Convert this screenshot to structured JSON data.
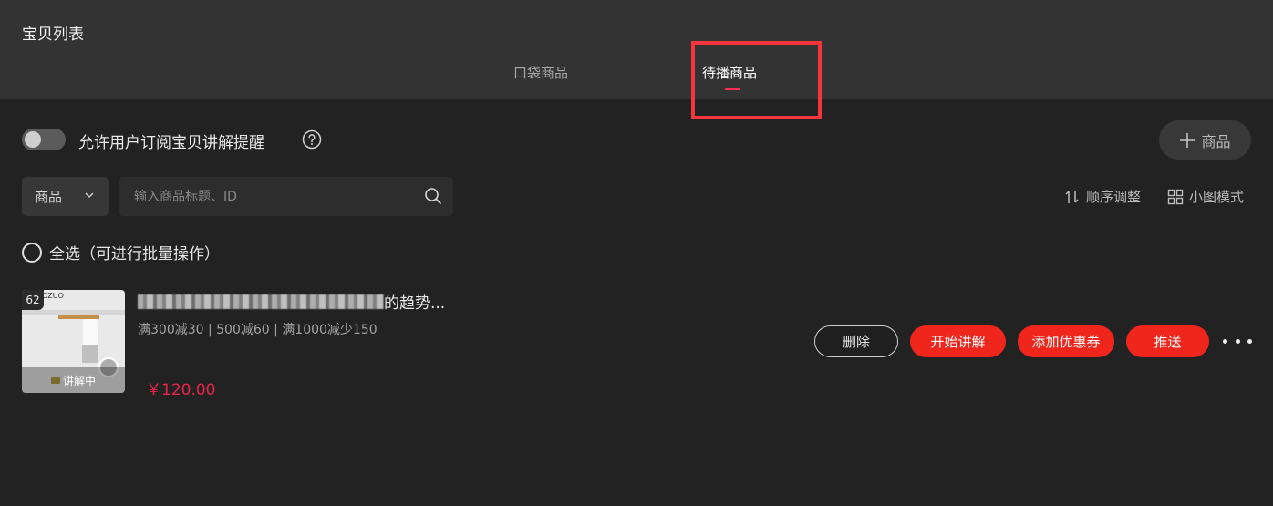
{
  "header": {
    "title": "宝贝列表",
    "tabs": [
      {
        "label": "口袋商品",
        "active": false
      },
      {
        "label": "待播商品",
        "active": true
      }
    ]
  },
  "subscribe_toggle": {
    "label": "允许用户订阅宝贝讲解提醒",
    "enabled": false
  },
  "add_button": {
    "label": "商品"
  },
  "filter": {
    "select_value": "商品",
    "search_placeholder": "输入商品标题、ID"
  },
  "tools": {
    "order_label": "顺序调整",
    "mode_label": "小图模式"
  },
  "select_all_label": "全选（可进行批量操作）",
  "product": {
    "index": "62",
    "brand": "OZUO",
    "live_badge": "讲解中",
    "title_suffix": "的趋势...",
    "promo": "满300减30 | 500减60 | 满1000减少150",
    "price": "￥120.00"
  },
  "actions": {
    "delete": "删除",
    "start": "开始讲解",
    "coupon": "添加优惠券",
    "push": "推送"
  },
  "colors": {
    "accent_red": "#f0261d",
    "price_red": "#e8254a",
    "highlight": "#f5343b",
    "tab_underline": "#ff2d55"
  }
}
